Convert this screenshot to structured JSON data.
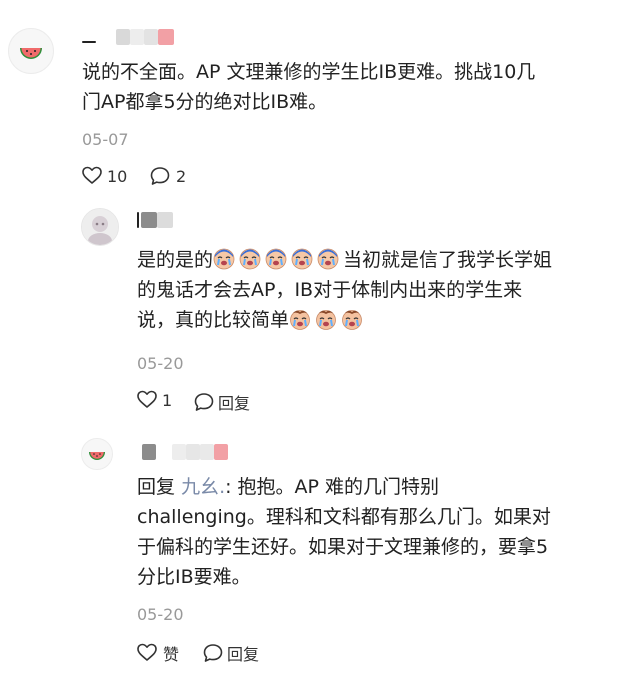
{
  "comment": {
    "text_line1": "说的不全面。AP 文理兼修的学生比IB更难。挑战10几",
    "text_line2": "门AP都拿5分的绝对比IB难。",
    "date": "05-07",
    "like_count": "10",
    "reply_count": "2"
  },
  "reply1": {
    "line1_text": "是的是的",
    "line1_tail": "当初就是信了我学长学姐",
    "line2": "的鬼话才会去AP，IB对于体制内出来的学生来",
    "line3_text": "说，真的比较简单",
    "date": "05-20",
    "like_count": "1",
    "reply_label": "回复"
  },
  "reply2": {
    "prefix": "回复",
    "target_name": "九幺.",
    "line1_tail": ": 抱抱。AP 难的几门特别",
    "line2": "challenging。理科和文科都有那么几门。如果对",
    "line3": "于偏科的学生还好。如果对于文理兼修的，要拿5",
    "line4": "分比IB要难。",
    "date": "05-20",
    "like_label": "赞",
    "reply_label": "回复"
  },
  "icons": {
    "heart": "heart-icon",
    "comment": "comment-bubble-icon",
    "watermelon": "watermelon-icon",
    "crying": "crying-face-emoji"
  },
  "colors": {
    "date": "#999999",
    "reply_name": "#7a8aa8",
    "blur_red": "#f2a0a5"
  }
}
